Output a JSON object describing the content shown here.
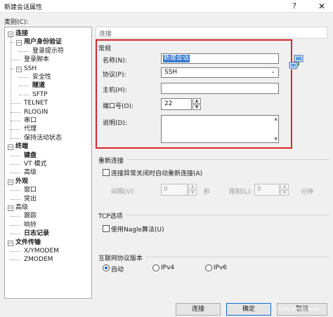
{
  "window": {
    "title": "新建会话属性",
    "help": "?",
    "close": "✕"
  },
  "category_label": "类别(C):",
  "tree": [
    {
      "label": "连接",
      "bold": true,
      "exp": "−"
    },
    {
      "label": "用户身份验证",
      "bold": true,
      "exp": "−"
    },
    {
      "label": "登录提示符",
      "bold": false
    },
    {
      "label": "登录脚本",
      "bold": false
    },
    {
      "label": "SSH",
      "bold": false,
      "exp": "−"
    },
    {
      "label": "安全性",
      "bold": false
    },
    {
      "label": "隧道",
      "bold": true
    },
    {
      "label": "SFTP",
      "bold": false
    },
    {
      "label": "TELNET",
      "bold": false
    },
    {
      "label": "RLOGIN",
      "bold": false
    },
    {
      "label": "串口",
      "bold": false
    },
    {
      "label": "代理",
      "bold": false
    },
    {
      "label": "保持活动状态",
      "bold": false
    },
    {
      "label": "终端",
      "bold": true,
      "exp": "−"
    },
    {
      "label": "键盘",
      "bold": true
    },
    {
      "label": "VT 模式",
      "bold": false
    },
    {
      "label": "高级",
      "bold": false
    },
    {
      "label": "外观",
      "bold": true,
      "exp": "−"
    },
    {
      "label": "窗口",
      "bold": false
    },
    {
      "label": "突出",
      "bold": false
    },
    {
      "label": "高级",
      "bold": false,
      "exp": "−"
    },
    {
      "label": "跟踪",
      "bold": false
    },
    {
      "label": "响铃",
      "bold": false
    },
    {
      "label": "日志记录",
      "bold": true
    },
    {
      "label": "文件传输",
      "bold": true,
      "exp": "−"
    },
    {
      "label": "X/YMODEM",
      "bold": false
    },
    {
      "label": "ZMODEM",
      "bold": false
    }
  ],
  "breadcrumb": "连接",
  "general": {
    "title": "常规",
    "name_label": "名称(N):",
    "name_value": "新建会话",
    "protocol_label": "协议(P):",
    "protocol_value": "SSH",
    "host_label": "主机(H):",
    "host_value": "",
    "port_label": "端口号(O):",
    "port_value": "22",
    "desc_label": "说明(D):",
    "desc_value": ""
  },
  "reconnect": {
    "title": "重新连接",
    "checkbox_label": "连接异常关闭时自动重新连接(A)",
    "interval_label": "间隔(V):",
    "interval_value": "0",
    "interval_unit": "秒",
    "limit_label": "限制(L):",
    "limit_value": "0",
    "limit_unit": "分钟"
  },
  "tcp": {
    "title": "TCP选项",
    "nagle_label": "使用Nagle算法(U)"
  },
  "ip_version": {
    "title": "互联网协议版本",
    "options": [
      "自动",
      "IPv4",
      "IPv6"
    ],
    "selected": "自动"
  },
  "buttons": {
    "connect": "连接",
    "ok": "确定",
    "cancel": "取消"
  },
  "watermark": "CSDN @Redfishes",
  "colors": {
    "highlight_border": "#d9262c",
    "selection": "#3277d3",
    "default_button_border": "#0b6bd3"
  }
}
